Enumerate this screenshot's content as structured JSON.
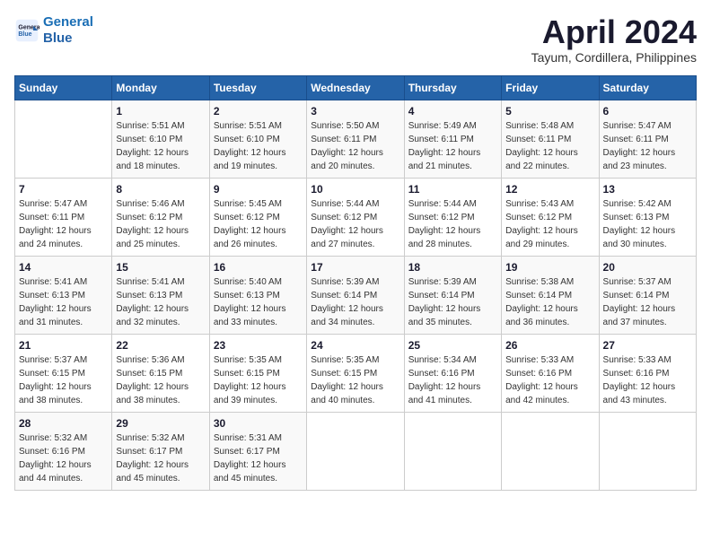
{
  "logo": {
    "line1": "General",
    "line2": "Blue"
  },
  "title": "April 2024",
  "subtitle": "Tayum, Cordillera, Philippines",
  "days_header": [
    "Sunday",
    "Monday",
    "Tuesday",
    "Wednesday",
    "Thursday",
    "Friday",
    "Saturday"
  ],
  "weeks": [
    [
      {
        "num": "",
        "detail": ""
      },
      {
        "num": "1",
        "detail": "Sunrise: 5:51 AM\nSunset: 6:10 PM\nDaylight: 12 hours\nand 18 minutes."
      },
      {
        "num": "2",
        "detail": "Sunrise: 5:51 AM\nSunset: 6:10 PM\nDaylight: 12 hours\nand 19 minutes."
      },
      {
        "num": "3",
        "detail": "Sunrise: 5:50 AM\nSunset: 6:11 PM\nDaylight: 12 hours\nand 20 minutes."
      },
      {
        "num": "4",
        "detail": "Sunrise: 5:49 AM\nSunset: 6:11 PM\nDaylight: 12 hours\nand 21 minutes."
      },
      {
        "num": "5",
        "detail": "Sunrise: 5:48 AM\nSunset: 6:11 PM\nDaylight: 12 hours\nand 22 minutes."
      },
      {
        "num": "6",
        "detail": "Sunrise: 5:47 AM\nSunset: 6:11 PM\nDaylight: 12 hours\nand 23 minutes."
      }
    ],
    [
      {
        "num": "7",
        "detail": "Sunrise: 5:47 AM\nSunset: 6:11 PM\nDaylight: 12 hours\nand 24 minutes."
      },
      {
        "num": "8",
        "detail": "Sunrise: 5:46 AM\nSunset: 6:12 PM\nDaylight: 12 hours\nand 25 minutes."
      },
      {
        "num": "9",
        "detail": "Sunrise: 5:45 AM\nSunset: 6:12 PM\nDaylight: 12 hours\nand 26 minutes."
      },
      {
        "num": "10",
        "detail": "Sunrise: 5:44 AM\nSunset: 6:12 PM\nDaylight: 12 hours\nand 27 minutes."
      },
      {
        "num": "11",
        "detail": "Sunrise: 5:44 AM\nSunset: 6:12 PM\nDaylight: 12 hours\nand 28 minutes."
      },
      {
        "num": "12",
        "detail": "Sunrise: 5:43 AM\nSunset: 6:12 PM\nDaylight: 12 hours\nand 29 minutes."
      },
      {
        "num": "13",
        "detail": "Sunrise: 5:42 AM\nSunset: 6:13 PM\nDaylight: 12 hours\nand 30 minutes."
      }
    ],
    [
      {
        "num": "14",
        "detail": "Sunrise: 5:41 AM\nSunset: 6:13 PM\nDaylight: 12 hours\nand 31 minutes."
      },
      {
        "num": "15",
        "detail": "Sunrise: 5:41 AM\nSunset: 6:13 PM\nDaylight: 12 hours\nand 32 minutes."
      },
      {
        "num": "16",
        "detail": "Sunrise: 5:40 AM\nSunset: 6:13 PM\nDaylight: 12 hours\nand 33 minutes."
      },
      {
        "num": "17",
        "detail": "Sunrise: 5:39 AM\nSunset: 6:14 PM\nDaylight: 12 hours\nand 34 minutes."
      },
      {
        "num": "18",
        "detail": "Sunrise: 5:39 AM\nSunset: 6:14 PM\nDaylight: 12 hours\nand 35 minutes."
      },
      {
        "num": "19",
        "detail": "Sunrise: 5:38 AM\nSunset: 6:14 PM\nDaylight: 12 hours\nand 36 minutes."
      },
      {
        "num": "20",
        "detail": "Sunrise: 5:37 AM\nSunset: 6:14 PM\nDaylight: 12 hours\nand 37 minutes."
      }
    ],
    [
      {
        "num": "21",
        "detail": "Sunrise: 5:37 AM\nSunset: 6:15 PM\nDaylight: 12 hours\nand 38 minutes."
      },
      {
        "num": "22",
        "detail": "Sunrise: 5:36 AM\nSunset: 6:15 PM\nDaylight: 12 hours\nand 38 minutes."
      },
      {
        "num": "23",
        "detail": "Sunrise: 5:35 AM\nSunset: 6:15 PM\nDaylight: 12 hours\nand 39 minutes."
      },
      {
        "num": "24",
        "detail": "Sunrise: 5:35 AM\nSunset: 6:15 PM\nDaylight: 12 hours\nand 40 minutes."
      },
      {
        "num": "25",
        "detail": "Sunrise: 5:34 AM\nSunset: 6:16 PM\nDaylight: 12 hours\nand 41 minutes."
      },
      {
        "num": "26",
        "detail": "Sunrise: 5:33 AM\nSunset: 6:16 PM\nDaylight: 12 hours\nand 42 minutes."
      },
      {
        "num": "27",
        "detail": "Sunrise: 5:33 AM\nSunset: 6:16 PM\nDaylight: 12 hours\nand 43 minutes."
      }
    ],
    [
      {
        "num": "28",
        "detail": "Sunrise: 5:32 AM\nSunset: 6:16 PM\nDaylight: 12 hours\nand 44 minutes."
      },
      {
        "num": "29",
        "detail": "Sunrise: 5:32 AM\nSunset: 6:17 PM\nDaylight: 12 hours\nand 45 minutes."
      },
      {
        "num": "30",
        "detail": "Sunrise: 5:31 AM\nSunset: 6:17 PM\nDaylight: 12 hours\nand 45 minutes."
      },
      {
        "num": "",
        "detail": ""
      },
      {
        "num": "",
        "detail": ""
      },
      {
        "num": "",
        "detail": ""
      },
      {
        "num": "",
        "detail": ""
      }
    ]
  ]
}
